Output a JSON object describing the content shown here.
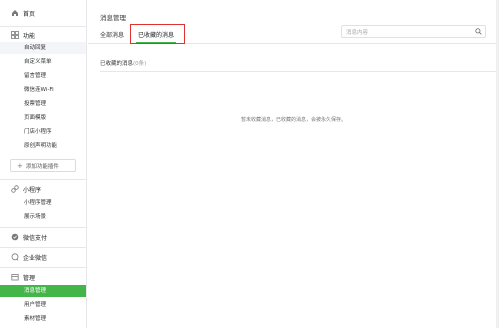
{
  "sidebar": {
    "home": {
      "label": "首页",
      "icon": "home-icon"
    },
    "features": {
      "label": "功能",
      "icon": "grid-icon",
      "items": [
        {
          "label": "自动回复"
        },
        {
          "label": "自定义菜单"
        },
        {
          "label": "留言管理"
        },
        {
          "label": "微信连Wi-Fi"
        },
        {
          "label": "投票管理"
        },
        {
          "label": "页面模版"
        },
        {
          "label": "门店小程序"
        },
        {
          "label": "原创声明功能"
        }
      ]
    },
    "add_plugin_label": "添加功能插件",
    "mini_program": {
      "label": "小程序",
      "icon": "link-icon",
      "items": [
        {
          "label": "小程序管理"
        },
        {
          "label": "展示场景"
        }
      ]
    },
    "wechat_pay": {
      "label": "微信支付",
      "icon": "pay-icon"
    },
    "enterprise": {
      "label": "企业微信",
      "icon": "chat-icon"
    },
    "manage": {
      "label": "管理",
      "icon": "box-icon",
      "items": [
        {
          "label": "消息管理"
        },
        {
          "label": "用户管理"
        },
        {
          "label": "素材管理"
        }
      ]
    }
  },
  "main": {
    "title": "消息管理",
    "tabs": [
      {
        "label": "全部消息"
      },
      {
        "label": "已收藏的消息"
      }
    ],
    "search": {
      "placeholder": "消息内容"
    },
    "section": {
      "label": "已收藏的消息",
      "count": "(0条)"
    },
    "empty_message": "暂未收藏消息，已收藏的消息，会被永久保存。"
  },
  "colors": {
    "accent": "#44b549",
    "highlight": "#e03131"
  }
}
